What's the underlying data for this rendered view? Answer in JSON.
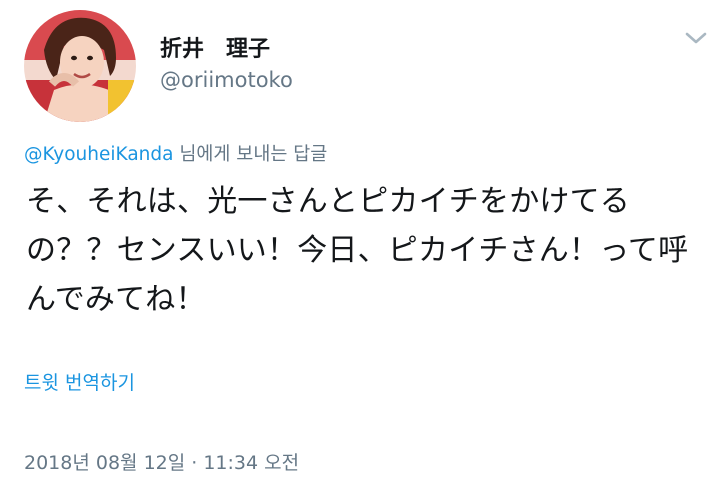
{
  "user": {
    "display_name": "折井　理子",
    "handle": "@oriimotoko",
    "avatar_icon": "profile-photo-avatar"
  },
  "menu": {
    "icon": "chevron-down-icon"
  },
  "reply": {
    "mention": "@KyouheiKanda",
    "suffix": " 님에게 보내는 답글"
  },
  "tweet": {
    "text": "そ、それは、光一さんとピカイチをかけてるの？？センスいい！今日、ピカイチさん！って呼んでみてね！"
  },
  "translate": {
    "label": "트윗 번역하기"
  },
  "timestamp": {
    "text": "2018년 08월 12일 · 11:34 오전"
  },
  "colors": {
    "link": "#1b95e0",
    "secondary_text": "#657786",
    "primary_text": "#14171a",
    "chevron": "#aab8c2"
  }
}
